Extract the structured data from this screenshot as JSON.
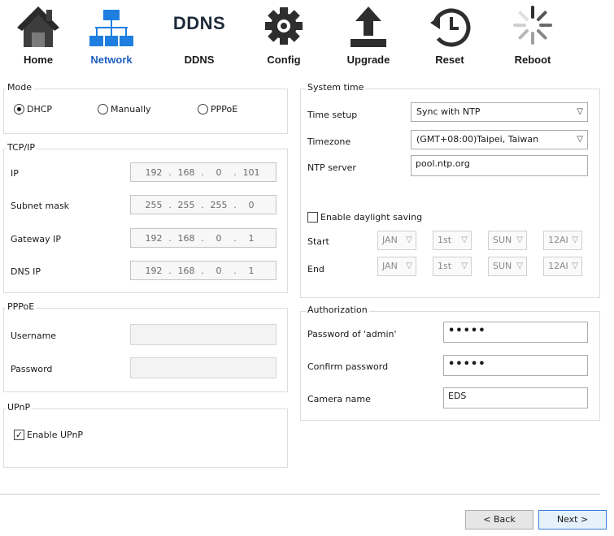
{
  "toolbar": {
    "items": [
      {
        "label": "Home"
      },
      {
        "label": "Network"
      },
      {
        "label": "DDNS",
        "icon_text": "DDNS"
      },
      {
        "label": "Config"
      },
      {
        "label": "Upgrade"
      },
      {
        "label": "Reset"
      },
      {
        "label": "Reboot"
      }
    ],
    "active_color": "#1f5fbf"
  },
  "mode": {
    "title": "Mode",
    "options": [
      "DHCP",
      "Manually",
      "PPPoE"
    ],
    "selected": "DHCP"
  },
  "tcpip": {
    "title": "TCP/IP",
    "fields": [
      {
        "label": "IP",
        "octets": [
          "192",
          "168",
          "0",
          "101"
        ]
      },
      {
        "label": "Subnet mask",
        "octets": [
          "255",
          "255",
          "255",
          "0"
        ]
      },
      {
        "label": "Gateway IP",
        "octets": [
          "192",
          "168",
          "0",
          "1"
        ]
      },
      {
        "label": "DNS IP",
        "octets": [
          "192",
          "168",
          "0",
          "1"
        ]
      }
    ]
  },
  "pppoe": {
    "title": "PPPoE",
    "username_label": "Username",
    "password_label": "Password"
  },
  "upnp": {
    "title": "UPnP",
    "enable_label": "Enable UPnP",
    "enabled": true
  },
  "system_time": {
    "title": "System time",
    "time_setup_label": "Time setup",
    "time_setup_value": "Sync with NTP",
    "timezone_label": "Timezone",
    "timezone_value": "(GMT+08:00)Taipei, Taiwan",
    "ntp_label": "NTP server",
    "ntp_value": "pool.ntp.org",
    "dst_label": "Enable daylight saving",
    "start_label": "Start",
    "end_label": "End",
    "start": {
      "month": "JAN",
      "week": "1st",
      "day": "SUN",
      "hour": "12AI"
    },
    "end": {
      "month": "JAN",
      "week": "1st",
      "day": "SUN",
      "hour": "12AI"
    }
  },
  "authorization": {
    "title": "Authorization",
    "password_label": "Password of 'admin'",
    "password_value": "•••••",
    "confirm_label": "Confirm password",
    "confirm_value": "•••••",
    "camera_label": "Camera name",
    "camera_value": "EDS"
  },
  "footer": {
    "back_label": "< Back",
    "next_label": "Next >"
  }
}
